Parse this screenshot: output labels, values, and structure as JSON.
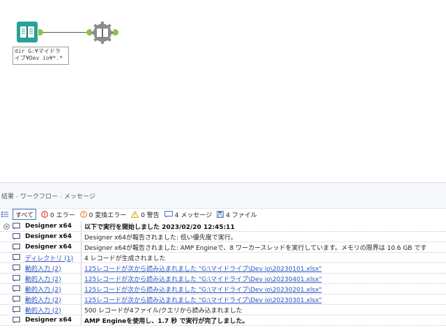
{
  "canvas": {
    "annotation": "dir G:¥マイドラ\nイブ¥Dev io¥*.*",
    "colors": {
      "tool_teal": "#2aa198",
      "tool_gray": "#8c8c8c",
      "anchor_green": "#8ac43f"
    }
  },
  "results": {
    "breadcrumb": {
      "part1": "結果",
      "sep": " - ",
      "part2": "ワークフロー",
      "part3": "メッセージ"
    },
    "filters": {
      "all": "すべて",
      "errors": "0 エラー",
      "conversion_errors": "0 変換エラー",
      "warnings": "0 警告",
      "messages": "4 メッセージ",
      "files": "4 ファイル"
    },
    "rows": [
      {
        "source": "Designer x64",
        "message": "以下で実行を開始しました 2023/02/20 12:45:11",
        "source_link": false,
        "msg_link": false,
        "bold": true
      },
      {
        "source": "Designer x64",
        "message": "Designer x64が報告されました: 低い優先度で実行。",
        "source_link": false,
        "msg_link": false,
        "bold": false
      },
      {
        "source": "Designer x64",
        "message": "Designer x64が報告されました: AMP Engineで、8 ワーカースレッドを実行しています。メモリの限界は 10.6 GB です",
        "source_link": false,
        "msg_link": false,
        "bold": false
      },
      {
        "source": "ディレクトリ (1)",
        "message": "4 レコードが生成されました",
        "source_link": true,
        "msg_link": false,
        "bold": false
      },
      {
        "source": "動的入力 (2)",
        "message": "125レコードが次から読み込まれました \"G:\\マイドライブ\\Dev io\\20230101.xlsx\"",
        "source_link": true,
        "msg_link": true,
        "bold": false
      },
      {
        "source": "動的入力 (2)",
        "message": "125レコードが次から読み込まれました \"G:\\マイドライブ\\Dev io\\20230401.xlsx\"",
        "source_link": true,
        "msg_link": true,
        "bold": false
      },
      {
        "source": "動的入力 (2)",
        "message": "125レコードが次から読み込まれました \"G:\\マイドライブ\\Dev io\\20230201.xlsx\"",
        "source_link": true,
        "msg_link": true,
        "bold": false
      },
      {
        "source": "動的入力 (2)",
        "message": "125レコードが次から読み込まれました \"G:\\マイドライブ\\Dev io\\20230301.xlsx\"",
        "source_link": true,
        "msg_link": true,
        "bold": false
      },
      {
        "source": "動的入力 (2)",
        "message": "500 レコードが4ファイル/クエリから読み込まれました",
        "source_link": true,
        "msg_link": false,
        "bold": false
      },
      {
        "source": "Designer x64",
        "message": "AMP Engineを使用し、1.7 秒 で実行が完了しました。",
        "source_link": false,
        "msg_link": false,
        "bold": true
      }
    ]
  }
}
